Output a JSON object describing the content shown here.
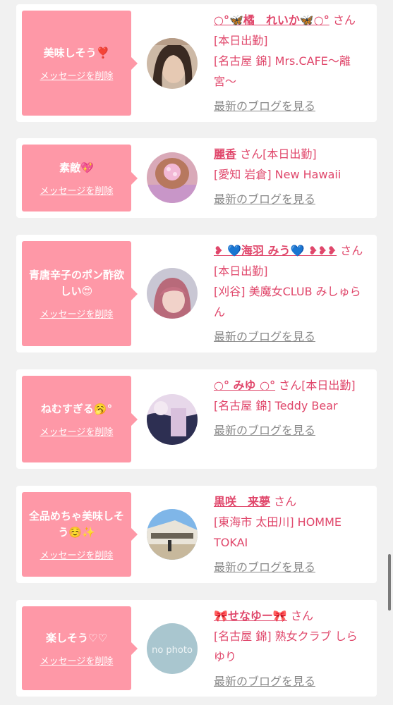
{
  "delete_label": "メッセージを削除",
  "blog_label": "最新のブログを見る",
  "san": "さん",
  "cards": [
    {
      "message": "美味しそう❣️",
      "name": "○°🦋橘　れいか🦋○°",
      "status": "[本日出勤]",
      "location": "[名古屋 錦] Mrs.CAFE〜離宮〜"
    },
    {
      "message": "素敵💖",
      "name": "麗香",
      "status": "[本日出勤]",
      "location": "[愛知 岩倉] New Hawaii"
    },
    {
      "message": "青唐辛子のポン酢欲しい😍",
      "name": "❥ 💙海羽 みう💙 ❥❥❥",
      "status": "[本日出勤]",
      "location": "[刈谷] 美魔女CLUB みしゅらん"
    },
    {
      "message": "ねむすぎる🥱°",
      "name": "○° みゆ ○°",
      "status": "[本日出勤]",
      "location": "[名古屋 錦] Teddy Bear"
    },
    {
      "message": "全品めちゃ美味しそう☺️✨",
      "name": "黒咲　来夢",
      "status": "",
      "location": "[東海市 太田川] HOMME TOKAI"
    },
    {
      "message": "楽しそう♡♡",
      "name": "🎀せなゆー🎀",
      "status": "",
      "location": "[名古屋 錦] 熟女クラブ しらゆり"
    }
  ],
  "no_photo_text": "no photo"
}
